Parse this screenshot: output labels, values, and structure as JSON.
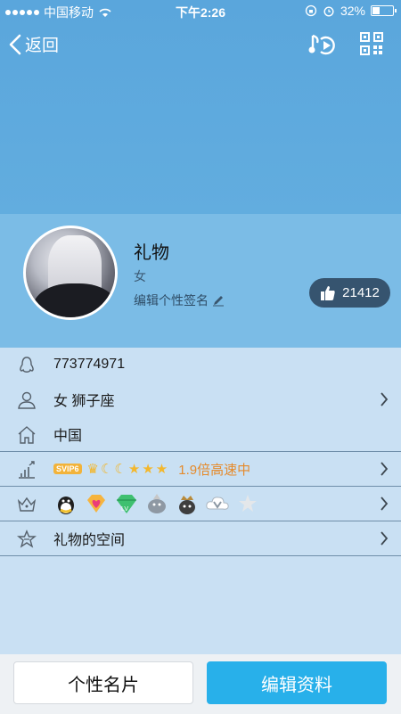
{
  "status_bar": {
    "carrier": "中国移动",
    "time": "下午2:26",
    "battery": "32%",
    "battery_level": 0.32
  },
  "nav": {
    "back_label": "返回",
    "music_icon": "music-play-icon",
    "qr_icon": "qr-code-icon"
  },
  "profile": {
    "name": "礼物",
    "gender": "女",
    "signature_placeholder": "编辑个性签名",
    "likes": "21412"
  },
  "info": {
    "qq_number": "773774971",
    "gender_zodiac": "女 狮子座",
    "location": "中国",
    "vip_badge": "SVIP6",
    "speed": "1.9倍高速中",
    "space": "礼物的空间"
  },
  "buttons": {
    "card_label": "个性名片",
    "edit_label": "编辑资料"
  },
  "colors": {
    "hero": "#5aa6dc",
    "profile_bg": "#7bbce6",
    "list_bg": "#c9e0f3",
    "accent": "#28b0ea",
    "like_bg": "#36546f",
    "speed": "#e58a2b"
  }
}
